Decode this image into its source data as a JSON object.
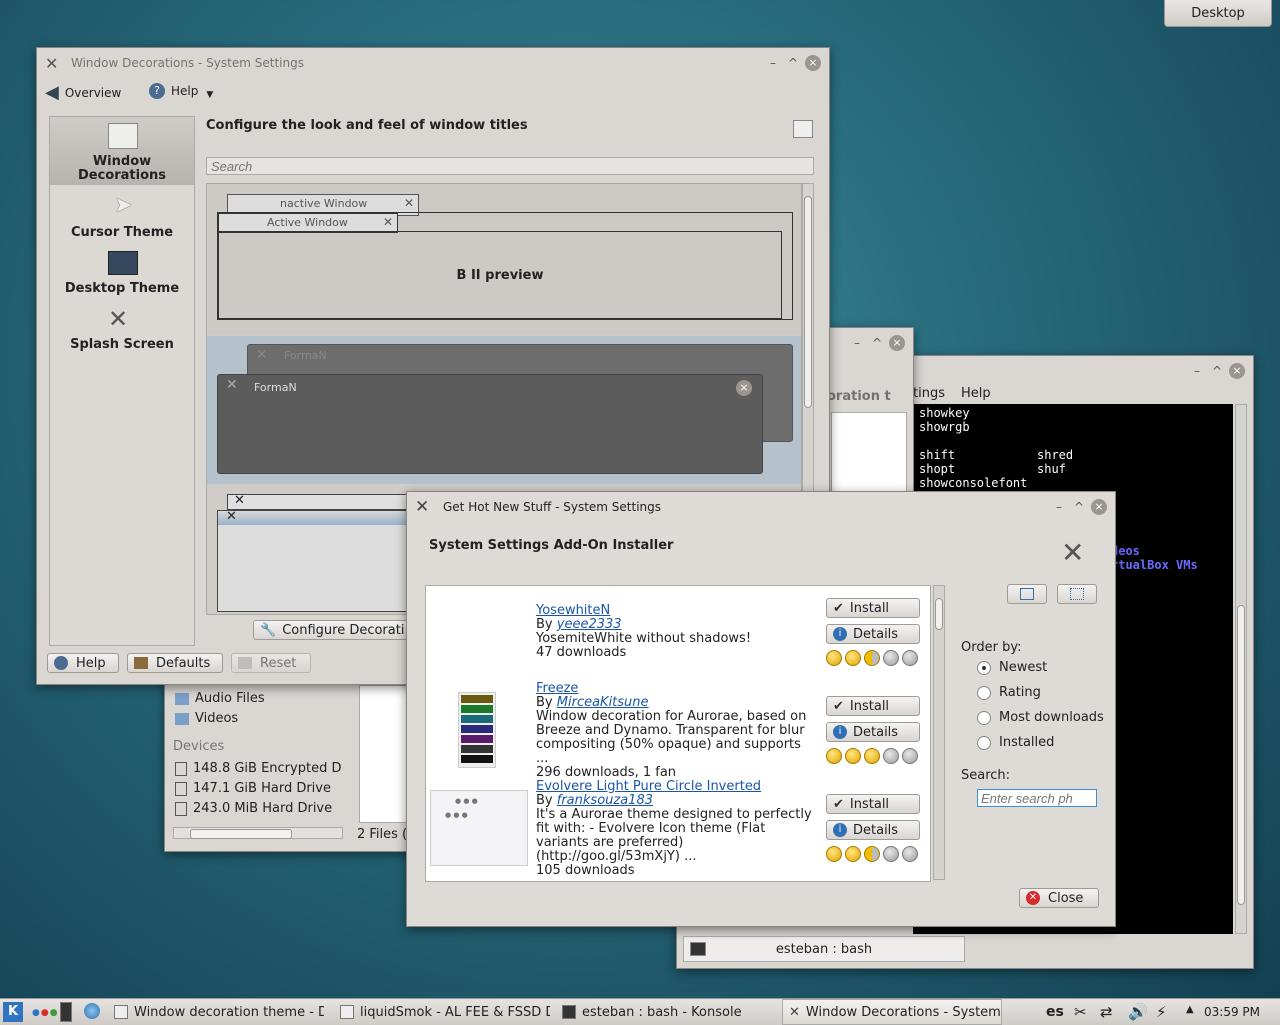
{
  "desktop": {
    "pager_label": "Desktop"
  },
  "settings_window": {
    "title": "Window Decorations - System Settings",
    "toolbar": {
      "overview": "Overview",
      "help": "Help"
    },
    "sidebar": [
      {
        "label": "Window Decorations",
        "icon": "window-decorations-icon"
      },
      {
        "label": "Cursor Theme",
        "icon": "cursor-icon"
      },
      {
        "label": "Desktop Theme",
        "icon": "desktop-theme-icon"
      },
      {
        "label": "Splash Screen",
        "icon": "splash-screen-icon"
      }
    ],
    "heading": "Configure the look and feel of window titles",
    "search_placeholder": "Search",
    "previews": {
      "inactive_window": "nactive Window",
      "active_window": "Active Window",
      "preview_label": "B II preview",
      "theme_name_back": "FormaN",
      "theme_name_front": "FormaN"
    },
    "configure_button": "Configure Decorati",
    "buttons": {
      "help": "Help",
      "defaults": "Defaults",
      "reset": "Reset"
    }
  },
  "file_manager": {
    "places": [
      "Audio Files",
      "Videos"
    ],
    "devices_header": "Devices",
    "devices": [
      "148.8 GiB Encrypted D",
      "147.1 GiB Hard Drive",
      "243.0 MiB Hard Drive"
    ],
    "status": "2 Files ("
  },
  "middle_window": {
    "partial_text": "oration t"
  },
  "konsole": {
    "menu": [
      "tings",
      "Help"
    ],
    "lines": [
      {
        "a": "showkey",
        "b": ""
      },
      {
        "a": "showrgb",
        "b": ""
      },
      {
        "a": "",
        "b": ""
      },
      {
        "a": "shift",
        "b": "shred"
      },
      {
        "a": "shopt",
        "b": "shuf"
      },
      {
        "a": "showconsolefont",
        "b": ""
      }
    ],
    "blue_lines": [
      "deos",
      "rtualBox VMs"
    ],
    "tab_label": "esteban : bash"
  },
  "ghns": {
    "title": "Get Hot New Stuff - System Settings",
    "heading": "System Settings Add-On Installer",
    "items": [
      {
        "name": "YosewhiteN",
        "by": "By",
        "author": "yeee2333",
        "desc": [
          "YosemiteWhite without shadows!"
        ],
        "stats": "47 downloads",
        "rating": 2.5,
        "install": "Install",
        "details": "Details"
      },
      {
        "name": "Freeze",
        "by": "By",
        "author": "MirceaKitsune",
        "desc": [
          "Window decoration for Aurorae, based on",
          "Breeze and Dynamo. Transparent for blur",
          "compositing (50% opaque) and supports",
          "..."
        ],
        "stats": "296 downloads, 1 fan",
        "rating": 3,
        "install": "Install",
        "details": "Details"
      },
      {
        "name": "Evolvere Light Pure Circle Inverted",
        "by": "By",
        "author": "franksouza183",
        "desc": [
          "It's a Aurorae theme designed to perfectly",
          "fit with: - Evolvere Icon theme (Flat",
          "variants are preferred)",
          "(http://goo.gl/53mXjY) ..."
        ],
        "stats": "105 downloads",
        "rating": 2.5,
        "install": "Install",
        "details": "Details"
      }
    ],
    "order_by_label": "Order by:",
    "order_options": [
      {
        "label": "Newest",
        "selected": true
      },
      {
        "label": "Rating",
        "selected": false
      },
      {
        "label": "Most downloads",
        "selected": false
      },
      {
        "label": "Installed",
        "selected": false
      }
    ],
    "search_label": "Search:",
    "search_placeholder": "Enter search ph",
    "close": "Close"
  },
  "taskbar": {
    "tasks": [
      "Window decoration theme - D",
      "liquidSmok - AL FEE & FSSD D",
      "esteban : bash - Konsole",
      "Window Decorations - System"
    ],
    "keyboard_layout": "es",
    "clock": "03:59 PM"
  },
  "colors": {
    "accent": "#3a8fd8",
    "link": "#1a55a8",
    "taskbar": "#dcd8d4",
    "terminal_bg": "#000000"
  }
}
